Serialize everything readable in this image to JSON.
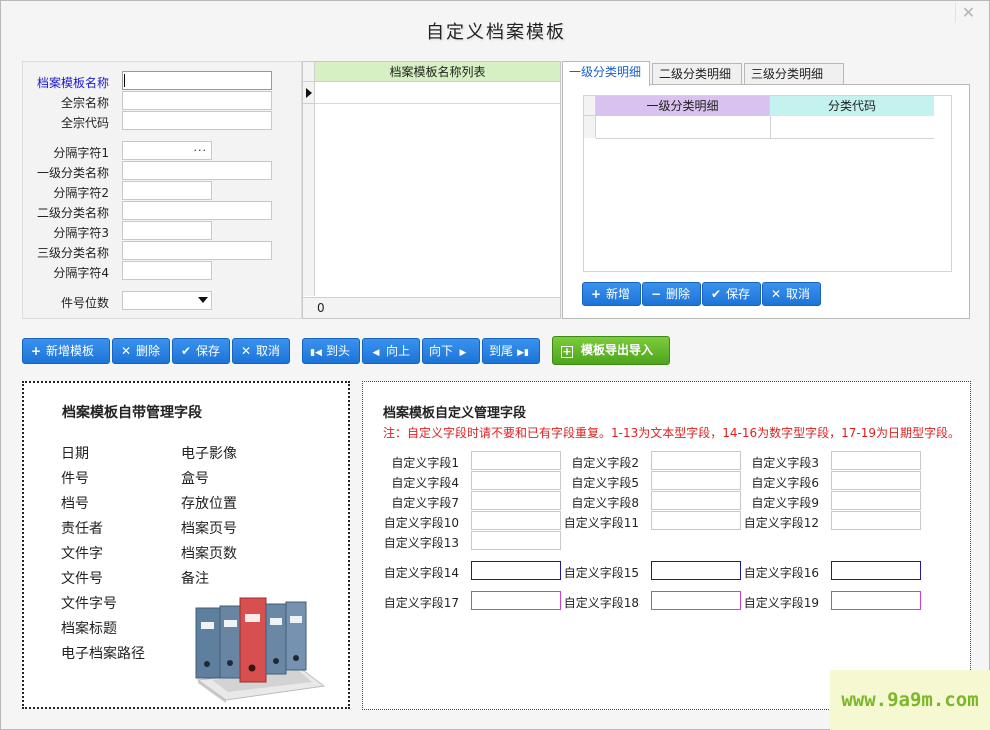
{
  "window": {
    "title": "自定义档案模板",
    "close_glyph": "✕"
  },
  "form": {
    "fields": [
      {
        "label": "档案模板名称",
        "value": ""
      },
      {
        "label": "全宗名称",
        "value": ""
      },
      {
        "label": "全宗代码",
        "value": ""
      },
      {
        "label": "分隔字符1",
        "value": "",
        "button": "···"
      },
      {
        "label": "一级分类名称",
        "value": ""
      },
      {
        "label": "分隔字符2",
        "value": ""
      },
      {
        "label": "二级分类名称",
        "value": ""
      },
      {
        "label": "分隔字符3",
        "value": ""
      },
      {
        "label": "三级分类名称",
        "value": ""
      },
      {
        "label": "分隔字符4",
        "value": ""
      },
      {
        "label": "件号位数",
        "value": ""
      }
    ]
  },
  "template_list": {
    "header": "档案模板名称列表",
    "count": "0"
  },
  "tabs": [
    {
      "label": "一级分类明细",
      "active": true
    },
    {
      "label": "二级分类明细",
      "active": false
    },
    {
      "label": "三级分类明细",
      "active": false
    }
  ],
  "category_grid": {
    "col1": "一级分类明细",
    "col2": "分类代码"
  },
  "category_buttons": {
    "add": "新增",
    "delete": "删除",
    "save": "保存",
    "cancel": "取消"
  },
  "toolbar": {
    "add_template": "新增模板",
    "delete": "删除",
    "save": "保存",
    "cancel": "取消",
    "first": "到头",
    "prev": "向上",
    "next": "向下",
    "last": "到尾",
    "export_import": "模板导出导入"
  },
  "fixed_fields": {
    "title": "档案模板自带管理字段",
    "col1": [
      "日期",
      "件号",
      "档号",
      "责任者",
      "文件字",
      "文件号",
      "文件字号",
      "档案标题",
      "电子档案路径"
    ],
    "col2": [
      "电子影像",
      "盒号",
      "存放位置",
      "档案页号",
      "档案页数",
      "备注"
    ]
  },
  "custom_fields": {
    "title": "档案模板自定义管理字段",
    "note": "注：自定义字段时请不要和已有字段重复。1-13为文本型字段，14-16为数字型字段，17-19为日期型字段。",
    "labels": [
      "自定义字段1",
      "自定义字段2",
      "自定义字段3",
      "自定义字段4",
      "自定义字段5",
      "自定义字段6",
      "自定义字段7",
      "自定义字段8",
      "自定义字段9",
      "自定义字段10",
      "自定义字段11",
      "自定义字段12",
      "自定义字段13",
      "自定义字段14",
      "自定义字段15",
      "自定义字段16",
      "自定义字段17",
      "自定义字段18",
      "自定义字段19"
    ]
  },
  "watermark": "www.9a9m.com",
  "colors": {
    "button_blue": "#1d74d8",
    "button_green": "#4ea51c",
    "list_header": "#d6f0c4",
    "grid_col1": "#d9c2ef",
    "grid_col2": "#c4f2ee",
    "note_red": "#e02020",
    "number_field": "#1a1aa0",
    "date_field": "#d040d0",
    "active_tab_text": "#1a60c8"
  }
}
